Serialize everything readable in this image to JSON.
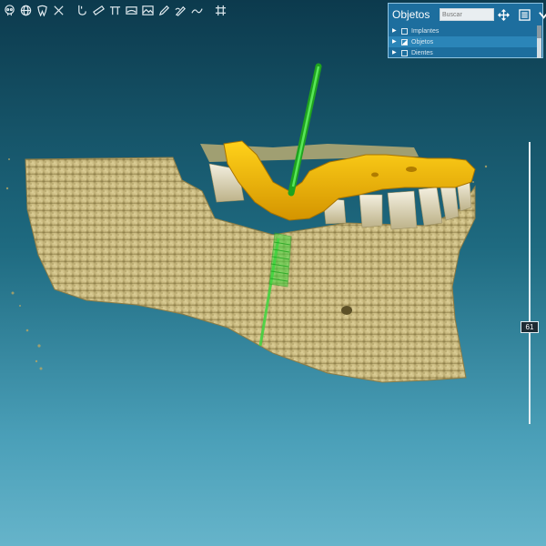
{
  "toolbar": {
    "tools": [
      "skull-icon",
      "globe-icon",
      "tooth-icon",
      "close-icon",
      "nerve-icon",
      "ruler-icon",
      "measure-icon",
      "panoramic-icon",
      "image-icon",
      "pen-icon",
      "draw-icon",
      "curve-icon",
      "grid-icon"
    ]
  },
  "objects_panel": {
    "title": "Objetos",
    "search_placeholder": "Buscar",
    "rows": [
      {
        "label": "Implantes",
        "checked": false
      },
      {
        "label": "Objetos",
        "checked": "partial",
        "selected": true
      },
      {
        "label": "Dientes",
        "checked": false
      }
    ]
  },
  "slider": {
    "value": "61",
    "level": 0.61
  },
  "colors": {
    "background_top": "#0c3a4d",
    "background_bottom": "#66b4ca",
    "bone": "#cfc08a",
    "guide": "#f0b800",
    "implant": "#3fd63f",
    "panel": "#1d6e9e"
  }
}
